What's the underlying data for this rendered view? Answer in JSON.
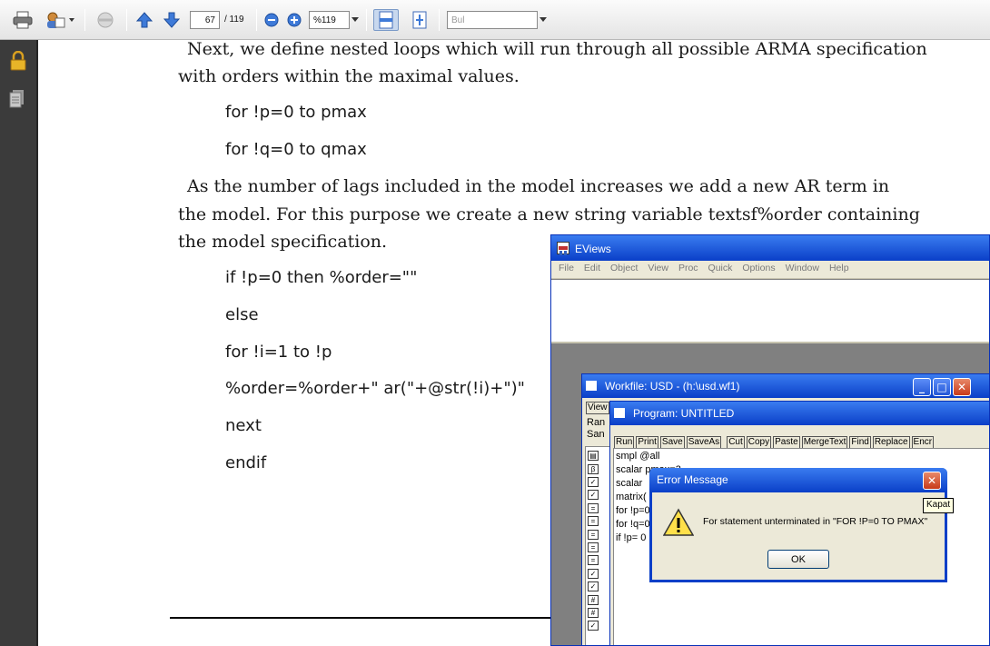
{
  "toolbar": {
    "page_current": "67",
    "page_total": "/ 119",
    "zoom": "%119",
    "find_placeholder": "Bul"
  },
  "doc": {
    "para1_line1": "Next, we define nested loops which will run through all possible ARMA specification",
    "para1_line2": "with orders within the maximal values.",
    "code1": "for !p=0 to pmax",
    "code2": "for !q=0 to qmax",
    "para2_line1": "As the number of lags included in the model increases we add a new AR term in",
    "para2_line2": "the model.  For this purpose we create a new string variable textsf%order containing",
    "para2_line3": "the model specification.",
    "code3": "if !p=0 then %order=\"\"",
    "code4": "else",
    "code5": "for !i=1 to !p",
    "code6": "%order=%order+\" ar(\"+@str(!i)+\")\"",
    "code7": "next",
    "code8": "endif"
  },
  "eviews": {
    "title": "EViews",
    "menu": [
      "File",
      "Edit",
      "Object",
      "View",
      "Proc",
      "Quick",
      "Options",
      "Window",
      "Help"
    ]
  },
  "workfile": {
    "title": "Workfile: USD - (h:\\usd.wf1)",
    "view_label": "View",
    "range_label": "Ran",
    "sample_label": "San"
  },
  "program": {
    "title": "Program: UNTITLED",
    "buttons": [
      "Run",
      "Print",
      "Save",
      "SaveAs",
      "Cut",
      "Copy",
      "Paste",
      "MergeText",
      "Find",
      "Replace",
      "Encr"
    ],
    "lines": [
      "smpl @all",
      "scalar pmax=3",
      "scalar",
      "matrix(",
      "for !p=0",
      "for !q=0",
      "if !p= 0"
    ]
  },
  "error_dialog": {
    "title": "Error Message",
    "message": "For statement unterminated in \"FOR !P=0 TO PMAX\"",
    "ok_label": "OK",
    "close_tooltip": "Kapat"
  },
  "colors": {
    "xp_title": "#0a3fc8",
    "panel": "#3b3b3b",
    "dialog_bg": "#ece9d8"
  }
}
